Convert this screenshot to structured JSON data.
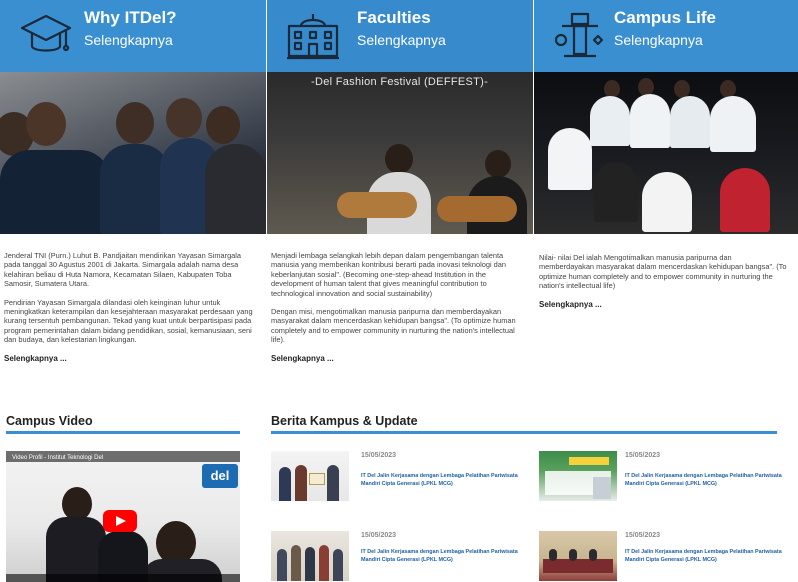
{
  "tiles": [
    {
      "title": "Why ITDel?",
      "link": "Selengkapnya",
      "icon": "graduation-cap-icon"
    },
    {
      "title": "Faculties",
      "link": "Selengkapnya",
      "icon": "building-icon"
    },
    {
      "title": "Campus Life",
      "link": "Selengkapnya",
      "icon": "monument-icon"
    }
  ],
  "photos": {
    "festival_banner": "-Del Fashion Festival (DEFFEST)-"
  },
  "descriptions": {
    "col1": {
      "p1": "Jenderal TNI (Purn.) Luhut B. Pandjaitan mendirikan Yayasan Simargala pada tanggal 30 Agustus 2001 di Jakarta. Simargala adalah nama desa kelahiran beliau di Huta Namora, Kecamatan Silaen, Kabupaten Toba Samosir, Sumatera Utara.",
      "p2": "Pendirian Yayasan Simargala dilandasi oleh keinginan luhur untuk meningkatkan keterampilan dan kesejahteraan masyarakat perdesaan yang kurang tersentuh pembangunan. Tekad yang kuat untuk berpartisipasi pada program pemerintahan dalam bidang pendidikan, sosial, kemanusiaan, seni dan budaya, dan kelestarian lingkungan.",
      "more": "Selengkapnya ..."
    },
    "col2": {
      "p1": "Menjadi lembaga selangkah lebih depan dalam pengembangan talenta manusia yang memberikan kontribusi berarti pada inovasi teknologi dan keberlanjutan sosial\". (Becoming one-step-ahead Institution in the development of human talent that gives meaningful contribution to technological innovation and social sustainability)",
      "p2": "Dengan misi, mengotimalkan manusia paripurna dan memberdayakan masyarakat dalam mencerdaskan kehidupan bangsa\". (To optimize human completely and to empower community in nurturing the nation's intellectual life).",
      "more": "Selengkapnya ..."
    },
    "col3": {
      "p1": "Nilai- nilai Del ialah Mengotimalkan manusia paripurna dan memberdayakan masyarakat dalam mencerdaskan kehidupan bangsa\". (To optimize human completely and to empower community in nurturing the nation's intellectual life)",
      "more": "Selengkapnya ..."
    }
  },
  "video_section": {
    "title": "Campus Video",
    "video_title": "Video Profil - Institut Teknologi Del",
    "logo_text": "del"
  },
  "news_section": {
    "title": "Berita Kampus & Update",
    "items": [
      {
        "date": "15/05/2023",
        "title": "IT Del Jalin Kerjasama dengan Lembaga Pelatihan Pariwisata Mandiri Cipta Generasi (LPKL MCG)"
      },
      {
        "date": "15/05/2023",
        "title": "IT Del Jalin Kerjasama dengan Lembaga Pelatihan Pariwisata Mandiri Cipta Generasi (LPKL MCG)"
      },
      {
        "date": "15/05/2023",
        "title": "IT Del Jalin Kerjasama dengan Lembaga Pelatihan Pariwisata Mandiri Cipta Generasi (LPKL MCG)"
      },
      {
        "date": "15/05/2023",
        "title": "IT Del Jalin Kerjasama dengan Lembaga Pelatihan Pariwisata Mandiri Cipta Generasi (LPKL MCG)"
      }
    ]
  },
  "colors": {
    "accent": "#3a8fd1",
    "link_blue": "#1f5fa5",
    "youtube_red": "#ff0000"
  }
}
